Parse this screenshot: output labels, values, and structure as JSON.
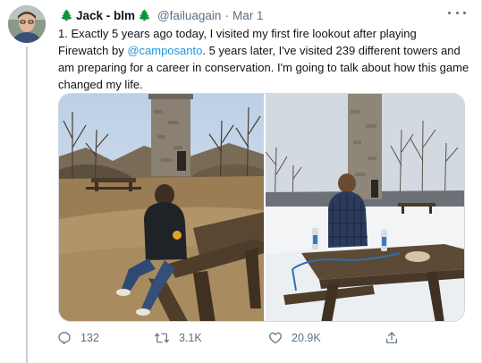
{
  "tweet": {
    "author_name": "Jack - blm",
    "name_emoji_left": "🌲",
    "name_emoji_right": "🌲",
    "handle": "@failuagain",
    "separator": "·",
    "date": "Mar 1",
    "text_part1": "1. Exactly 5 years ago today, I visited my first fire lookout after playing Firewatch by ",
    "mention": "@camposanto",
    "text_part2": ". 5 years later, I've visited 239 different towers and am preparing for a career in conservation. I'm going to talk about how this game changed my life."
  },
  "actions": {
    "replies": "132",
    "retweets": "3.1K",
    "likes": "20.9K"
  },
  "icons": {
    "more": "more-options-icon",
    "reply": "reply-icon",
    "retweet": "retweet-icon",
    "like": "like-icon",
    "share": "share-icon"
  },
  "colors": {
    "secondary_text": "#5b7083",
    "link": "#1b95e0",
    "thread_line": "#c4cfd6",
    "border": "#cfd9de"
  }
}
